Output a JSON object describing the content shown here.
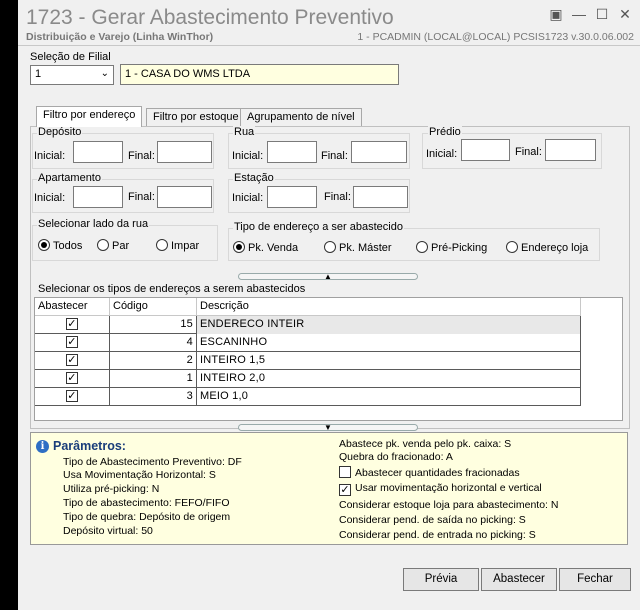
{
  "window": {
    "title": "1723 - Gerar Abastecimento Preventivo",
    "subtitle": "Distribuição e Varejo (Linha WinThor)",
    "sysinfo": "1 - PCADMIN (LOCAL@LOCAL)   PCSIS1723  v.30.0.06.002",
    "controls": {
      "restore": "▣",
      "minimize": "—",
      "maximize": "☐",
      "close": "✕"
    }
  },
  "filial": {
    "label": "Seleção de Filial",
    "selected": "1",
    "name": "1 - CASA DO WMS LTDA"
  },
  "tabs": [
    {
      "label": "Filtro por endereço",
      "active": true
    },
    {
      "label": "Filtro por estoque",
      "active": false
    },
    {
      "label": "Agrupamento de nível",
      "active": false
    }
  ],
  "filters": {
    "deposito": {
      "title": "Depósito",
      "inicial": "Inicial:",
      "final": "Final:"
    },
    "rua": {
      "title": "Rua",
      "inicial": "Inicial:",
      "final": "Final:"
    },
    "predio": {
      "title": "Prédio",
      "inicial": "Inicial:",
      "final": "Final:"
    },
    "apartamento": {
      "title": "Apartamento",
      "inicial": "Inicial:",
      "final": "Final:"
    },
    "estacao": {
      "title": "Estação",
      "inicial": "Inicial:",
      "final": "Final:"
    }
  },
  "lado_rua": {
    "title": "Selecionar lado da rua",
    "options": [
      "Todos",
      "Par",
      "Impar"
    ],
    "selected": "Todos"
  },
  "tipo_endereco": {
    "title": "Tipo de endereço a ser abastecido",
    "options": [
      "Pk. Venda",
      "Pk. Máster",
      "Pré-Picking",
      "Endereço loja"
    ],
    "selected": "Pk. Venda"
  },
  "grid": {
    "title": "Selecionar os tipos de endereços a serem abastecidos",
    "columns": [
      "Abastecer",
      "Código",
      "Descrição"
    ],
    "rows": [
      {
        "abastecer": true,
        "codigo": "15",
        "descricao": "ENDERECO INTEIR"
      },
      {
        "abastecer": true,
        "codigo": "4",
        "descricao": "ESCANINHO"
      },
      {
        "abastecer": true,
        "codigo": "2",
        "descricao": "INTEIRO 1,5"
      },
      {
        "abastecer": true,
        "codigo": "1",
        "descricao": "INTEIRO 2,0"
      },
      {
        "abastecer": true,
        "codigo": "3",
        "descricao": "MEIO 1,0"
      }
    ]
  },
  "parametros": {
    "title": "Parâmetros:",
    "left": [
      "Tipo de Abastecimento Preventivo: DF",
      "Usa Movimentação Horizontal: S",
      "Utiliza pré-picking: N",
      "Tipo de abastecimento: FEFO/FIFO",
      "Tipo de quebra: Depósito de origem",
      "Depósito virtual: 50"
    ],
    "right_top": [
      "Abastece pk. venda pelo pk. caixa: S",
      "Quebra do fracionado: A"
    ],
    "checkbox_fracionadas": {
      "label": "Abastecer quantidades fracionadas",
      "checked": false
    },
    "checkbox_movimentacao": {
      "label": "Usar movimentação horizontal e vertical",
      "checked": true
    },
    "right_bottom": [
      "Considerar estoque loja para abastecimento: N",
      "Considerar pend. de saída no picking: S",
      "Considerar pend. de entrada no picking: S"
    ]
  },
  "buttons": {
    "previa": "Prévia",
    "abastecer": "Abastecer",
    "fechar": "Fechar"
  }
}
